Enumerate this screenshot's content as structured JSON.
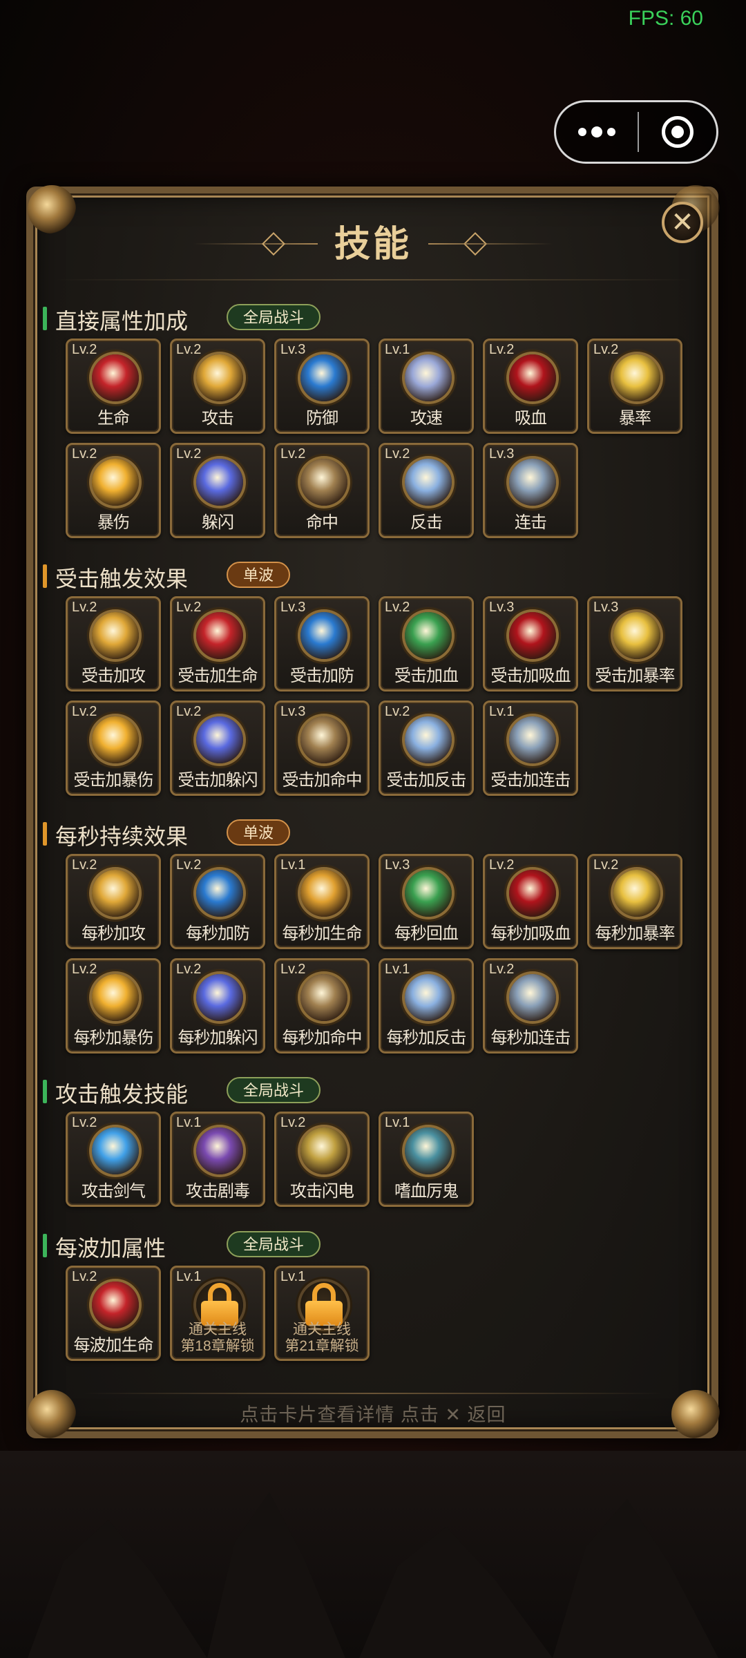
{
  "status": {
    "fps": "FPS: 60"
  },
  "panel": {
    "title": "技能",
    "close_label": "✕",
    "footer": "点击卡片查看详情    点击 ✕ 返回"
  },
  "sections": [
    {
      "title": "直接属性加成",
      "badge": "全局战斗",
      "badge_style": "green",
      "bar_color": "#3cb45a",
      "cards": [
        {
          "lv": "Lv.2",
          "name": "生命",
          "icon": "heart-gem-icon",
          "color": "#c4242a"
        },
        {
          "lv": "Lv.2",
          "name": "攻击",
          "icon": "trident-icon",
          "color": "#e0a838"
        },
        {
          "lv": "Lv.3",
          "name": "防御",
          "icon": "shield-icon",
          "color": "#2a7ad0"
        },
        {
          "lv": "Lv.1",
          "name": "攻速",
          "icon": "wind-blades-icon",
          "color": "#9aa8d8"
        },
        {
          "lv": "Lv.2",
          "name": "吸血",
          "icon": "blood-vortex-icon",
          "color": "#b0141c"
        },
        {
          "lv": "Lv.2",
          "name": "暴率",
          "icon": "lightning-orb-icon",
          "color": "#e8c040"
        },
        {
          "lv": "Lv.2",
          "name": "暴伤",
          "icon": "starburst-icon",
          "color": "#f0b030"
        },
        {
          "lv": "Lv.2",
          "name": "躲闪",
          "icon": "blue-swirl-icon",
          "color": "#5a6ae0"
        },
        {
          "lv": "Lv.2",
          "name": "命中",
          "icon": "target-icon",
          "color": "#a08050"
        },
        {
          "lv": "Lv.2",
          "name": "反击",
          "icon": "crossed-swords-icon",
          "color": "#8ab0e0"
        },
        {
          "lv": "Lv.3",
          "name": "连击",
          "icon": "claw-slashes-icon",
          "color": "#8aa0b8"
        }
      ]
    },
    {
      "title": "受击触发效果",
      "badge": "单波",
      "badge_style": "orange",
      "bar_color": "#e0962a",
      "cards": [
        {
          "lv": "Lv.2",
          "name": "受击加攻",
          "icon": "trident-icon",
          "color": "#e0a838"
        },
        {
          "lv": "Lv.2",
          "name": "受击加生命",
          "icon": "heart-gem-icon",
          "color": "#c4242a"
        },
        {
          "lv": "Lv.3",
          "name": "受击加防",
          "icon": "shield-icon",
          "color": "#2a7ad0"
        },
        {
          "lv": "Lv.2",
          "name": "受击加血",
          "icon": "green-cross-icon",
          "color": "#3aa050"
        },
        {
          "lv": "Lv.3",
          "name": "受击加吸血",
          "icon": "blood-vortex-icon",
          "color": "#b0141c"
        },
        {
          "lv": "Lv.3",
          "name": "受击加暴率",
          "icon": "lightning-orb-icon",
          "color": "#e8c040"
        },
        {
          "lv": "Lv.2",
          "name": "受击加暴伤",
          "icon": "starburst-icon",
          "color": "#f0b030"
        },
        {
          "lv": "Lv.2",
          "name": "受击加躲闪",
          "icon": "blue-swirl-icon",
          "color": "#5a6ae0"
        },
        {
          "lv": "Lv.3",
          "name": "受击加命中",
          "icon": "target-icon",
          "color": "#a08050"
        },
        {
          "lv": "Lv.2",
          "name": "受击加反击",
          "icon": "crossed-swords-icon",
          "color": "#8ab0e0"
        },
        {
          "lv": "Lv.1",
          "name": "受击加连击",
          "icon": "claw-slashes-icon",
          "color": "#8aa0b8"
        }
      ]
    },
    {
      "title": "每秒持续效果",
      "badge": "单波",
      "badge_style": "orange",
      "bar_color": "#e0962a",
      "cards": [
        {
          "lv": "Lv.2",
          "name": "每秒加攻",
          "icon": "trident-icon",
          "color": "#e0a838"
        },
        {
          "lv": "Lv.2",
          "name": "每秒加防",
          "icon": "shield-icon",
          "color": "#2a7ad0"
        },
        {
          "lv": "Lv.1",
          "name": "每秒加生命",
          "icon": "golden-swirl-icon",
          "color": "#e0a030"
        },
        {
          "lv": "Lv.3",
          "name": "每秒回血",
          "icon": "green-cross-icon",
          "color": "#3aa050"
        },
        {
          "lv": "Lv.2",
          "name": "每秒加吸血",
          "icon": "blood-vortex-icon",
          "color": "#b0141c"
        },
        {
          "lv": "Lv.2",
          "name": "每秒加暴率",
          "icon": "lightning-orb-icon",
          "color": "#e8c040"
        },
        {
          "lv": "Lv.2",
          "name": "每秒加暴伤",
          "icon": "starburst-icon",
          "color": "#f0b030"
        },
        {
          "lv": "Lv.2",
          "name": "每秒加躲闪",
          "icon": "blue-swirl-icon",
          "color": "#5a6ae0"
        },
        {
          "lv": "Lv.2",
          "name": "每秒加命中",
          "icon": "target-icon",
          "color": "#a08050"
        },
        {
          "lv": "Lv.1",
          "name": "每秒加反击",
          "icon": "crossed-swords-icon",
          "color": "#8ab0e0"
        },
        {
          "lv": "Lv.2",
          "name": "每秒加连击",
          "icon": "claw-slashes-icon",
          "color": "#8aa0b8"
        }
      ]
    },
    {
      "title": "攻击触发技能",
      "badge": "全局战斗",
      "badge_style": "green",
      "bar_color": "#3cb45a",
      "cards": [
        {
          "lv": "Lv.2",
          "name": "攻击剑气",
          "icon": "crescent-slash-icon",
          "color": "#40a0e8"
        },
        {
          "lv": "Lv.1",
          "name": "攻击剧毒",
          "icon": "poison-skull-icon",
          "color": "#7a4ab0"
        },
        {
          "lv": "Lv.2",
          "name": "攻击闪电",
          "icon": "lightning-bolt-icon",
          "color": "#c0a040"
        },
        {
          "lv": "Lv.1",
          "name": "嗜血厉鬼",
          "icon": "demon-sigil-icon",
          "color": "#4a90a0"
        }
      ]
    },
    {
      "title": "每波加属性",
      "badge": "全局战斗",
      "badge_style": "green",
      "bar_color": "#3cb45a",
      "cards": [
        {
          "lv": "Lv.2",
          "name": "每波加生命",
          "icon": "heart-gem-icon",
          "color": "#c4242a"
        },
        {
          "lv": "Lv.1",
          "locked": true,
          "lock_line1": "通关主线",
          "lock_line2": "第18章解锁",
          "icon": "lock-icon",
          "color": "#f0a430"
        },
        {
          "lv": "Lv.1",
          "locked": true,
          "lock_line1": "通关主线",
          "lock_line2": "第21章解锁",
          "icon": "lock-icon",
          "color": "#f0a430"
        }
      ]
    }
  ]
}
